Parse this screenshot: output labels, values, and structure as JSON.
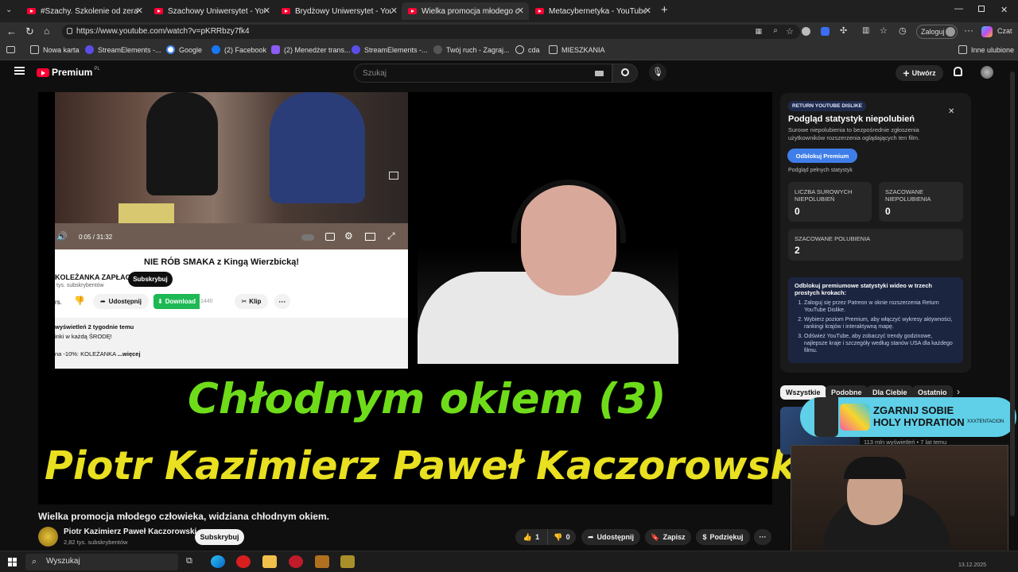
{
  "browser": {
    "tabs": [
      {
        "label": "#Szachy. Szkolenie od zera, szalon"
      },
      {
        "label": "Szachowy Uniwersytet - YouTube"
      },
      {
        "label": "Brydżowy Uniwersytet - YouTube"
      },
      {
        "label": "Wielka promocja młodego człowie"
      },
      {
        "label": "Metacybernetyka - YouTube"
      }
    ],
    "url": "https://www.youtube.com/watch?v=pKRRbzy7fk4",
    "login_label": "Zaloguj",
    "chat_label": "Czat",
    "bookmarks": [
      "Nowa karta",
      "StreamElements -...",
      "Google",
      "(2) Facebook",
      "(2) Menedżer trans...",
      "StreamElements -...",
      "Twój ruch - Zagraj...",
      "cda",
      "MIESZKANIA"
    ],
    "other_bookmarks": "Inne ulubione"
  },
  "youtube": {
    "logo": "Premium",
    "logo_region": "PL",
    "search_placeholder": "Szukaj",
    "create_label": "Utwórz"
  },
  "embedded_video": {
    "time": "0:05 / 31:32",
    "title": "NIE RÓB SMAKA z Kingą Wierzbicką!",
    "channel": "KOLEŻANKA ZAPŁACI",
    "subs": "tys. subskrybentów",
    "subscribe": "Subskrybuj",
    "likes_partial": "rs.",
    "share": "Udostępnij",
    "download": "Download",
    "download_count": "1440",
    "clip": "Klip",
    "desc_line1": "wyświetleń  2 tygodnie temu",
    "desc_line2": "inki w każdą ŚRODĘ!",
    "desc_line3": "na -10%: KOLEŻANKA",
    "desc_more": "...więcej"
  },
  "overlay": {
    "line1": "Chłodnym okiem (3)",
    "line2": "Piotr Kazimierz Paweł Kaczorowski",
    "line1_color": "#6fdc1a",
    "line2_color": "#e8e020"
  },
  "video": {
    "title": "Wielka promocja młodego człowieka, widziana chłodnym okiem.",
    "channel": "Piotr Kazimierz Paweł Kaczorowski",
    "subscribers": "2,82 tys. subskrybentów",
    "subscribe": "Subskrybuj",
    "likes": "1",
    "dislikes": "0",
    "share": "Udostępnij",
    "save": "Zapisz",
    "thanks": "Podziękuj"
  },
  "ryd": {
    "badge": "RETURN YOUTUBE DISLIKE",
    "heading": "Podgląd statystyk niepolubień",
    "description": "Surowe niepolubienia to bezpośrednie zgłoszenia użytkowników rozszerzenia oglądających ten film.",
    "unlock_button": "Odblokuj Premium",
    "preview_label": "Podgląd pełnych statystyk",
    "raw_dislikes_label": "LICZBA SUROWYCH NIEPOLUBIEŃ",
    "raw_dislikes": "0",
    "est_dislikes_label": "SZACOWANE NIEPOLUBIENIA",
    "est_dislikes": "0",
    "est_likes_label": "SZACOWANE POLUBIENIA",
    "est_likes": "2",
    "promo_heading": "Odblokuj premiumowe statystyki wideo w trzech prostych krokach:",
    "steps": [
      "Zaloguj się przez Patreon w oknie rozszerzenia Return YouTube Dislike.",
      "Wybierz poziom Premium, aby włączyć wykresy aktywności, rankingi krajów i interaktywną mapę.",
      "Odśwież YouTube, aby zobaczyć trendy godzinowe, najlepsze kraje i szczegóły według stanów USA dla każdego filmu."
    ]
  },
  "chips": [
    "Wszystkie",
    "Podobne",
    "Dla Ciebie",
    "Ostatnio"
  ],
  "sidebar_video": {
    "meta": "113 mln wyświetleń • 7 lat temu"
  },
  "ad_banner": {
    "line1": "ZGARNIJ SOBIE",
    "line2": "HOLY HYDRATION",
    "brand": "XXXTENTACION"
  },
  "taskbar": {
    "search": "Wyszukaj",
    "date": "13.12.2025"
  }
}
